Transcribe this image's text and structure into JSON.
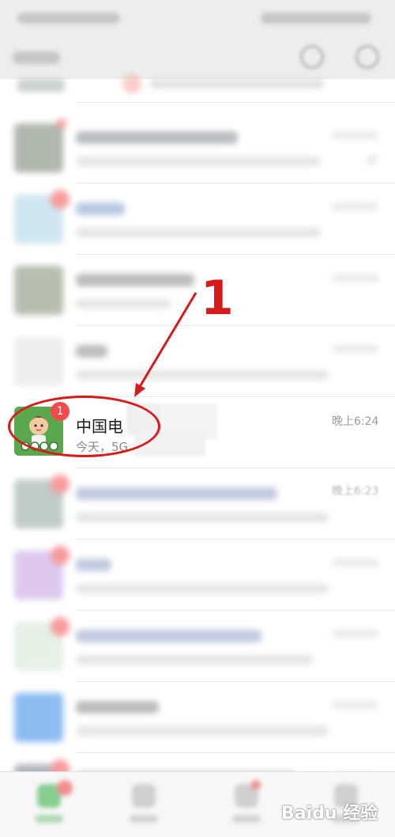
{
  "highlighted_chat": {
    "name": "中国电",
    "preview": "今天，5G",
    "time": "晚上6:24",
    "badge_count": "1"
  },
  "visible_time_next_row": "晚上6:23",
  "annotation": {
    "step_number": "1",
    "color": "#d71a1a"
  },
  "watermark": "Baidu 经验",
  "colors": {
    "badge": "#f24a4a",
    "avatar_green": "#5aa84e",
    "blue_app": "#2f86e6"
  }
}
